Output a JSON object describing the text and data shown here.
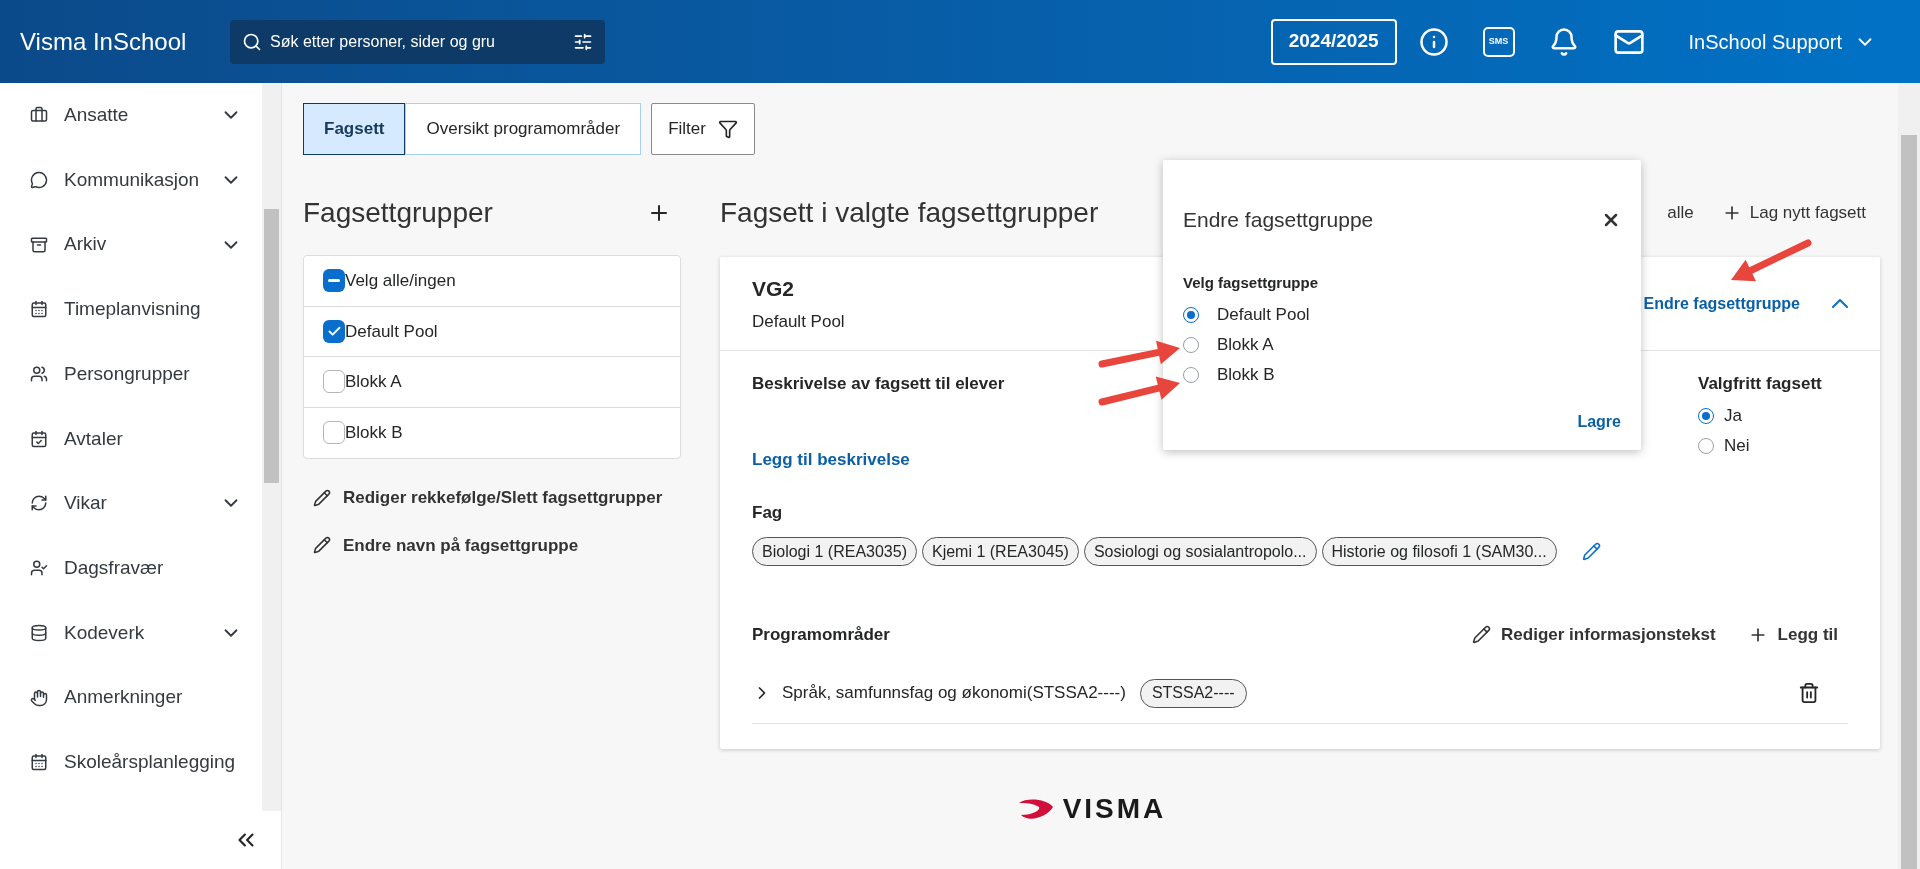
{
  "header": {
    "title": "Visma InSchool",
    "search_placeholder": "Søk etter personer, sider og gru",
    "year": "2024/2025",
    "sms_label": "SMS",
    "user": "InSchool Support"
  },
  "sidebar": {
    "items": [
      {
        "label": "Ansatte",
        "expandable": true
      },
      {
        "label": "Kommunikasjon",
        "expandable": true
      },
      {
        "label": "Arkiv",
        "expandable": true
      },
      {
        "label": "Timeplanvisning",
        "expandable": false
      },
      {
        "label": "Persongrupper",
        "expandable": false
      },
      {
        "label": "Avtaler",
        "expandable": false
      },
      {
        "label": "Vikar",
        "expandable": true
      },
      {
        "label": "Dagsfravær",
        "expandable": false
      },
      {
        "label": "Kodeverk",
        "expandable": true
      },
      {
        "label": "Anmerkninger",
        "expandable": false
      },
      {
        "label": "Skoleårsplanlegging",
        "expandable": false
      }
    ]
  },
  "tabs": [
    {
      "label": "Fagsett",
      "selected": true
    },
    {
      "label": "Oversikt programområder",
      "selected": false
    }
  ],
  "filter_button": "Filter",
  "groups": {
    "title": "Fagsettgrupper",
    "select_all": {
      "label": "Velg alle/ingen",
      "indeterminate": true
    },
    "items": [
      {
        "label": "Default Pool",
        "checked": true
      },
      {
        "label": "Blokk A",
        "checked": false
      },
      {
        "label": "Blokk B",
        "checked": false
      }
    ],
    "links": [
      "Rediger rekkefølge/Slett fagsettgrupper",
      "Endre navn på fagsettgruppe"
    ]
  },
  "content": {
    "title": "Fagsett i valgte fagsettgrupper",
    "actions": [
      {
        "label": "alle",
        "kind": "plain"
      },
      {
        "label": "Lag nytt fagsett",
        "kind": "add"
      }
    ],
    "card": {
      "name": "VG2",
      "group": "Default Pool",
      "change_link": "Endre fagsettgruppe",
      "expanded": true,
      "description_label": "Beskrivelse av fagsett til elever",
      "add_description_link": "Legg til beskrivelse",
      "optional": {
        "label": "Valgfritt fagsett",
        "options": [
          {
            "label": "Ja",
            "selected": true
          },
          {
            "label": "Nei",
            "selected": false
          }
        ]
      },
      "subjects_label": "Fag",
      "subjects": [
        "Biologi 1 (REA3035)",
        "Kjemi 1 (REA3045)",
        "Sosiologi og sosialantropolo...",
        "Historie og filosofi 1 (SAM30..."
      ],
      "programs_label": "Programområder",
      "program_actions": [
        {
          "label": "Rediger informasjonstekst",
          "kind": "edit"
        },
        {
          "label": "Legg til",
          "kind": "add"
        }
      ],
      "programs": [
        {
          "name": "Språk, samfunnsfag og økonomi(STSSA2----)",
          "code": "STSSA2----",
          "expanded": false
        }
      ]
    }
  },
  "dialog": {
    "title": "Endre fagsettgruppe",
    "field_label": "Velg fagsettgruppe",
    "options": [
      {
        "label": "Default Pool",
        "selected": true
      },
      {
        "label": "Blokk A",
        "selected": false
      },
      {
        "label": "Blokk B",
        "selected": false
      }
    ],
    "save": "Lagre"
  },
  "footer": {
    "logo": "VISMA"
  }
}
